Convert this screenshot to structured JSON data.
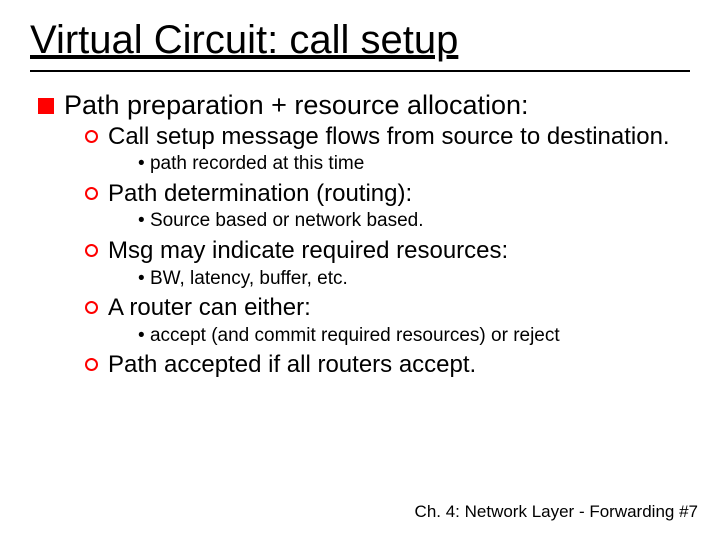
{
  "title": "Virtual Circuit: call setup",
  "main_point": "Path preparation + resource allocation:",
  "items": [
    {
      "text": "Call setup message flows from source to destination.",
      "sub": "path recorded at this time"
    },
    {
      "text": "Path determination (routing):",
      "sub": "Source based or network based."
    },
    {
      "text": "Msg may indicate required resources:",
      "sub": "BW, latency, buffer, etc."
    },
    {
      "text": "A router can either:",
      "sub": "accept (and commit required resources) or reject"
    },
    {
      "text": "Path accepted if all routers accept.",
      "sub": null
    }
  ],
  "footer": "Ch. 4: Network Layer - Forwarding  #7"
}
